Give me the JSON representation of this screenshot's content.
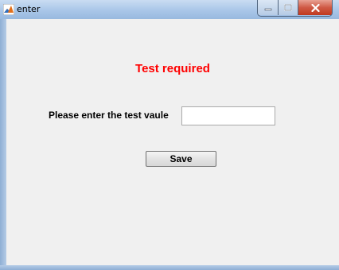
{
  "window": {
    "title": "enter",
    "app_icon": "matlab-logo-icon",
    "controls": [
      "minimize-icon",
      "maximize-icon",
      "close-icon"
    ]
  },
  "form": {
    "heading": "Test required",
    "prompt_label": "Please enter the test vaule",
    "input_value": "",
    "save_label": "Save"
  },
  "colors": {
    "heading": "#ff0000",
    "client_background": "#f0f0f0",
    "close_button": "#c0391f"
  }
}
